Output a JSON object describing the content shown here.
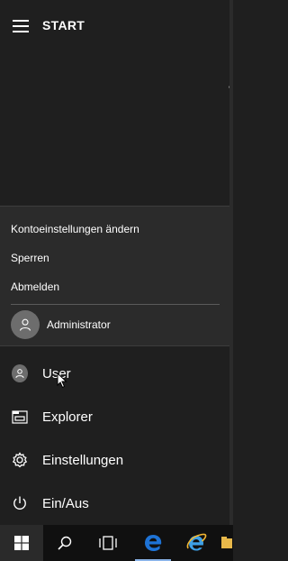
{
  "start_menu": {
    "title": "START"
  },
  "account_flyout": {
    "items": [
      {
        "label": "Kontoeinstellungen ändern"
      },
      {
        "label": "Sperren"
      },
      {
        "label": "Abmelden"
      }
    ],
    "other_user": "Administrator"
  },
  "left_column": {
    "user": "User",
    "explorer": "Explorer",
    "settings": "Einstellungen",
    "power": "Ein/Aus"
  },
  "taskbar": {
    "buttons": [
      "windows-start",
      "search",
      "task-view",
      "edge",
      "internet-explorer"
    ]
  },
  "colors": {
    "background": "#1f1f1f",
    "flyout": "#2b2b2b",
    "taskbar": "#101010",
    "edge_blue": "#1e73d6"
  }
}
